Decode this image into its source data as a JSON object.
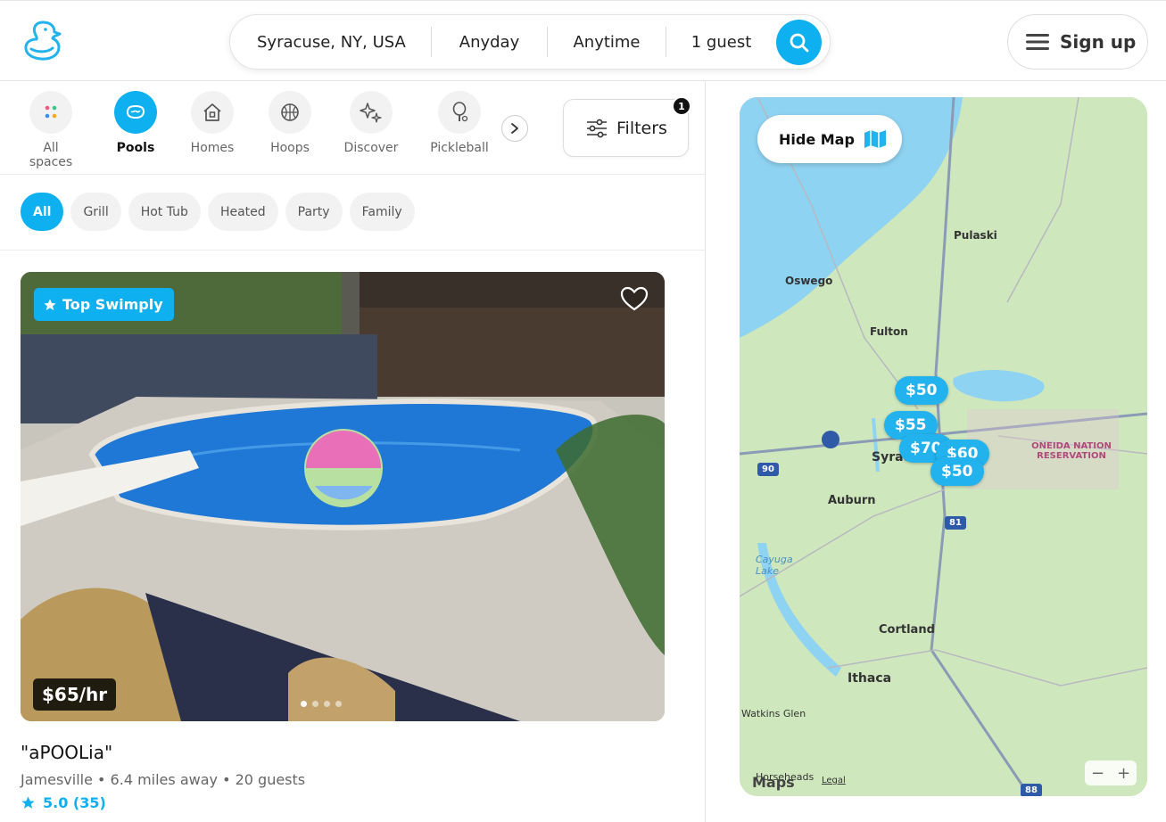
{
  "header": {
    "search": {
      "location": "Syracuse, NY, USA",
      "date": "Anyday",
      "time": "Anytime",
      "guests": "1 guest"
    },
    "signup_label": "Sign up"
  },
  "categories": [
    {
      "label": "All spaces",
      "icon": "dots-icon"
    },
    {
      "label": "Pools",
      "icon": "pool-icon"
    },
    {
      "label": "Homes",
      "icon": "home-icon"
    },
    {
      "label": "Hoops",
      "icon": "basketball-icon"
    },
    {
      "label": "Discover",
      "icon": "sparkle-icon"
    },
    {
      "label": "Pickleball",
      "icon": "pickleball-icon"
    }
  ],
  "active_category": "Pools",
  "filters": {
    "label": "Filters",
    "count": "1"
  },
  "chips": [
    "All",
    "Grill",
    "Hot Tub",
    "Heated",
    "Party",
    "Family"
  ],
  "active_chip": "All",
  "listing": {
    "badge": "Top Swimply",
    "price": "$65/hr",
    "title": "\"aPOOLia\"",
    "meta": "Jamesville • 6.4 miles away • 20 guests",
    "rating": "5.0 (35)"
  },
  "map": {
    "hide_label": "Hide Map",
    "pins": [
      "$50",
      "$55",
      "$70",
      "$60",
      "$50"
    ],
    "labels": {
      "pulaski": "Pulaski",
      "oswego": "Oswego",
      "fulton": "Fulton",
      "syracuse": "Syracuse",
      "auburn": "Auburn",
      "cayuga": "Cayuga Lake",
      "oneida": "ONEIDA NATION RESERVATION",
      "cortland": "Cortland",
      "ithaca": "Ithaca",
      "watkins": "Watkins Glen",
      "horseheads": "Horseheads",
      "i90": "90",
      "i81": "81",
      "i88": "88"
    },
    "legal": "Legal",
    "brand": "Maps"
  },
  "colors": {
    "accent": "#0fb0ef",
    "map_land": "#cfe7bd",
    "map_water": "#8fd3f2"
  }
}
